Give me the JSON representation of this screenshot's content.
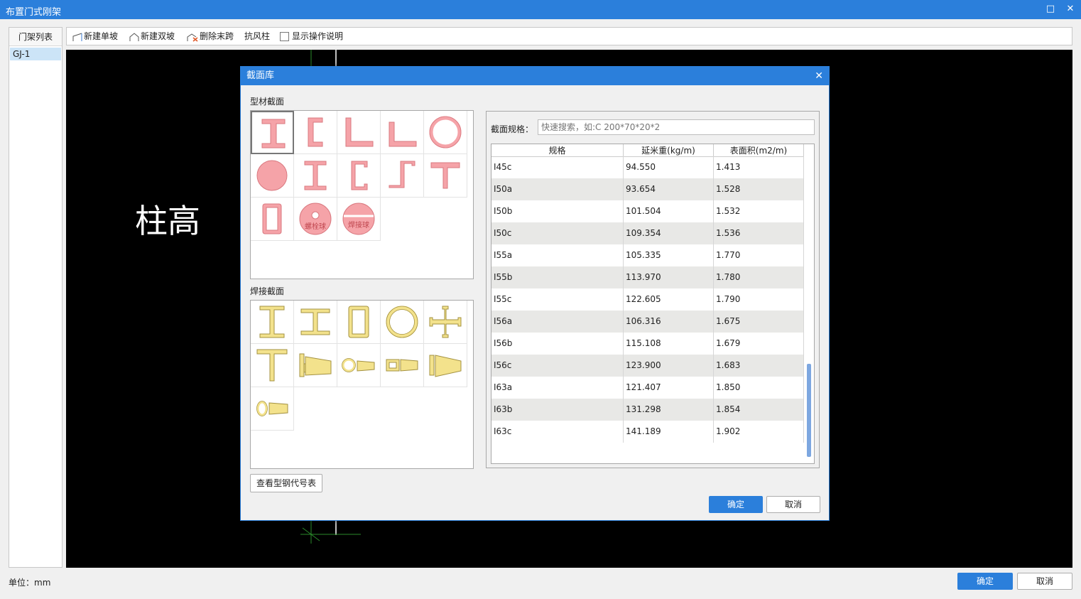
{
  "window": {
    "title": "布置门式刚架",
    "maximize_glyph": "□",
    "close_glyph": "✕"
  },
  "left_panel": {
    "header": "门架列表",
    "items": [
      "GJ-1"
    ]
  },
  "toolbar": {
    "new_single": "新建单坡",
    "new_double": "新建双坡",
    "delete_last": "删除末跨",
    "wind_column": "抗风柱",
    "show_help": "显示操作说明"
  },
  "canvas": {
    "column_height_label": "柱高"
  },
  "status": {
    "unit": "单位：mm"
  },
  "footer": {
    "ok": "确定",
    "cancel": "取消"
  },
  "dialog": {
    "title": "截面库",
    "close_glyph": "✕",
    "profile_section_label": "型材截面",
    "welded_section_label": "焊接截面",
    "bolt_ball": "螺栓球",
    "weld_ball": "焊接球",
    "view_codes_button": "查看型钢代号表",
    "search_label": "截面规格：",
    "search_placeholder": "快速搜索，如:C 200*70*20*2",
    "columns": [
      "规格",
      "延米重(kg/m)",
      "表面积(m2/m)"
    ],
    "rows": [
      [
        "I45c",
        "94.550",
        "1.413"
      ],
      [
        "I50a",
        "93.654",
        "1.528"
      ],
      [
        "I50b",
        "101.504",
        "1.532"
      ],
      [
        "I50c",
        "109.354",
        "1.536"
      ],
      [
        "I55a",
        "105.335",
        "1.770"
      ],
      [
        "I55b",
        "113.970",
        "1.780"
      ],
      [
        "I55c",
        "122.605",
        "1.790"
      ],
      [
        "I56a",
        "106.316",
        "1.675"
      ],
      [
        "I56b",
        "115.108",
        "1.679"
      ],
      [
        "I56c",
        "123.900",
        "1.683"
      ],
      [
        "I63a",
        "121.407",
        "1.850"
      ],
      [
        "I63b",
        "131.298",
        "1.854"
      ],
      [
        "I63c",
        "141.189",
        "1.902"
      ]
    ],
    "ok": "确定",
    "cancel": "取消"
  },
  "colors": {
    "accent": "#2b7fdb",
    "profile_fill": "#f5a3a8",
    "welded_fill": "#f3e28c"
  }
}
